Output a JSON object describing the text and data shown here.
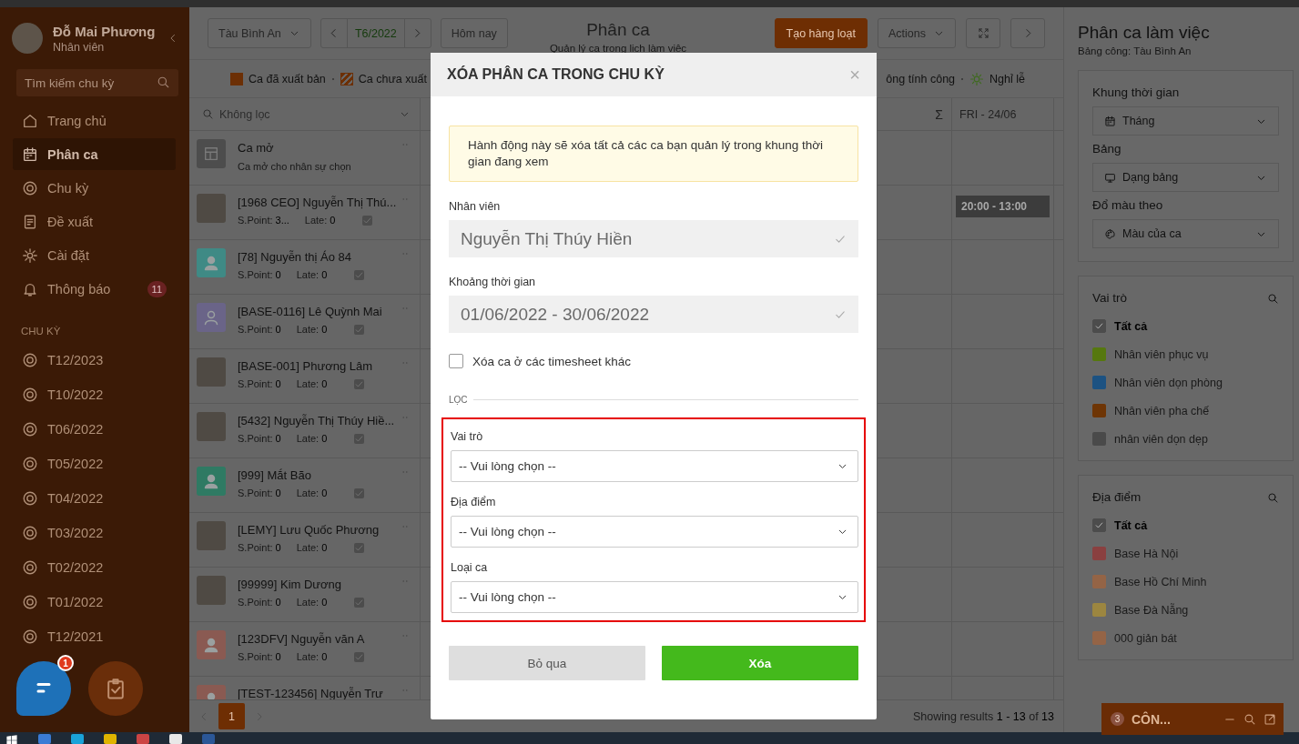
{
  "sidebar": {
    "user_name": "Đỗ Mai Phương",
    "user_role": "Nhân viên",
    "search_placeholder": "Tìm kiếm chu kỳ",
    "menu": [
      {
        "label": "Trang chủ",
        "selected": false
      },
      {
        "label": "Phân ca",
        "selected": true
      },
      {
        "label": "Chu kỳ",
        "selected": false
      },
      {
        "label": "Đề xuất",
        "selected": false
      },
      {
        "label": "Cài đặt",
        "selected": false
      },
      {
        "label": "Thông báo",
        "selected": false,
        "badge": "11"
      }
    ],
    "section_title": "CHU KỲ",
    "cycles": [
      "T12/2023",
      "T10/2022",
      "T06/2022",
      "T05/2022",
      "T04/2022",
      "T03/2022",
      "T02/2022",
      "T01/2022",
      "T12/2021"
    ],
    "chat_badge": "1"
  },
  "toolbar": {
    "store": "Tàu Bình An",
    "month": "T6/2022",
    "today": "Hôm nay",
    "title": "Phân ca",
    "subtitle": "Quản lý ca trong lịch làm việc",
    "bulk_button": "Tạo hàng loạt",
    "actions": "Actions"
  },
  "legend": {
    "left": [
      {
        "label": "Ca đã xuất bản",
        "kind": "solid"
      },
      {
        "label": "Ca chưa xuất",
        "kind": "striped"
      }
    ],
    "right": [
      {
        "label": "ông tính công",
        "kind": "none"
      },
      {
        "label": "Nghỉ lễ",
        "kind": "sun"
      }
    ]
  },
  "grid": {
    "filter": "Không lọc",
    "sum_header": "Σ",
    "day_header": "FRI - 24/06",
    "open_row": {
      "title": "Ca mở",
      "subtitle": "Ca mở cho nhân sự chọn"
    },
    "rows": [
      {
        "name": "[1968 CEO] Nguyễn Thị Thú...",
        "kind": "photo",
        "spoint_label": "S.Point:",
        "spoint": "3...",
        "late_label": "Late:",
        "late": "0",
        "shift": "20:00 - 13:00"
      },
      {
        "name": "[78] Nguyễn thị Áo 84",
        "kind": "person",
        "color": "#3f8a85",
        "spoint_label": "S.Point:",
        "spoint": "0",
        "late_label": "Late:",
        "late": "0"
      },
      {
        "name": "[BASE-0116] Lê Quỳnh Mai",
        "kind": "outline",
        "color": "#6a6488",
        "spoint_label": "S.Point:",
        "spoint": "0",
        "late_label": "Late:",
        "late": "0"
      },
      {
        "name": "[BASE-001] Phương Lâm",
        "kind": "photo",
        "spoint_label": "S.Point:",
        "spoint": "0",
        "late_label": "Late:",
        "late": "0"
      },
      {
        "name": "[5432] Nguyễn Thị Thúy Hiề...",
        "kind": "photo",
        "spoint_label": "S.Point:",
        "spoint": "0",
        "late_label": "Late:",
        "late": "0"
      },
      {
        "name": "[999] Mắt Bão",
        "kind": "person",
        "color": "#2f7a63",
        "spoint_label": "S.Point:",
        "spoint": "0",
        "late_label": "Late:",
        "late": "0"
      },
      {
        "name": "[LEMY] Lưu Quốc Phương",
        "kind": "photo",
        "spoint_label": "S.Point:",
        "spoint": "0",
        "late_label": "Late:",
        "late": "0"
      },
      {
        "name": "[99999] Kim Dương",
        "kind": "photo",
        "spoint_label": "S.Point:",
        "spoint": "0",
        "late_label": "Late:",
        "late": "0"
      },
      {
        "name": "[123DFV] Nguyễn văn A",
        "kind": "person",
        "color": "#8a5a52",
        "spoint_label": "S.Point:",
        "spoint": "0",
        "late_label": "Late:",
        "late": "0"
      },
      {
        "name": "[TEST-123456] Nguyễn Trư",
        "kind": "person",
        "color": "#8a5a52"
      }
    ],
    "pages": [
      {
        "label": "1",
        "selected": true
      }
    ],
    "results": "Showing results **1 - 13** of **13**"
  },
  "right_panel": {
    "title": "Phân ca làm việc",
    "subtitle": "Bảng công: Tàu Bình An",
    "settings": [
      {
        "label": "Khung thời gian",
        "value": "Tháng"
      },
      {
        "label": "Bảng",
        "value": "Dạng bảng"
      },
      {
        "label": "Đổ màu theo",
        "value": "Màu của ca"
      }
    ],
    "filters": [
      {
        "title": "Vai trò",
        "items": [
          {
            "label": "Tất cả",
            "kind": "check",
            "checked": true
          },
          {
            "label": "Nhân viên phục vụ",
            "kind": "color",
            "color": "#56780f"
          },
          {
            "label": "Nhân viên dọn phòng",
            "kind": "color",
            "color": "#1c5282"
          },
          {
            "label": "Nhân viên pha chế",
            "kind": "color",
            "color": "#6e3505"
          },
          {
            "label": "nhân viên dọn dẹp",
            "kind": "color",
            "color": "#4a4a4a"
          }
        ]
      },
      {
        "title": "Địa điểm",
        "items": [
          {
            "label": "Tất cả",
            "kind": "check",
            "checked": true
          },
          {
            "label": "Base Hà Nội",
            "kind": "color",
            "color": "#8a4040"
          },
          {
            "label": "Base Hồ Chí Minh",
            "kind": "color",
            "color": "#946446"
          },
          {
            "label": "Base Đà Nẵng",
            "kind": "color",
            "color": "#9c8640"
          },
          {
            "label": "000 giản bát",
            "kind": "color",
            "color": "#946446"
          }
        ]
      }
    ],
    "chat_bar": {
      "count": "3",
      "label": "CÔN..."
    }
  },
  "modal": {
    "title": "XÓA PHÂN CA TRONG CHU KỲ",
    "close": "×",
    "warning": "Hành động này sẽ xóa tất cả các ca bạn quản lý trong khung thời gian đang xem",
    "fields": [
      {
        "label": "Nhân viên",
        "value": "Nguyễn Thị Thúy Hiền",
        "disabled": true
      },
      {
        "label": "Khoảng thời gian",
        "value": "01/06/2022 - 30/06/2022",
        "disabled": true
      }
    ],
    "other_sheets": {
      "label": "Xóa ca ở các timesheet khác",
      "checked": false
    },
    "section": "LỌC",
    "filters_highlighted": true,
    "filters": [
      {
        "label": "Vai trò",
        "value": "-- Vui lòng chọn --"
      },
      {
        "label": "Địa điểm",
        "value": "-- Vui lòng chọn --"
      },
      {
        "label": "Loại ca",
        "value": "-- Vui lòng chọn --"
      }
    ],
    "cancel": "Bỏ qua",
    "confirm": "Xóa"
  }
}
